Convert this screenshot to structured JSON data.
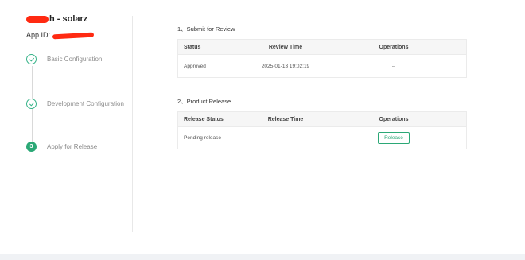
{
  "app": {
    "title_suffix": "h - solarz",
    "id_label": "App ID:"
  },
  "steps": [
    {
      "label": "Basic Configuration",
      "status": "done",
      "icon": "check-circle-icon"
    },
    {
      "label": "Development Configuration",
      "status": "done",
      "icon": "check-circle-icon"
    },
    {
      "label": "Apply for Release",
      "status": "active",
      "number": "3"
    }
  ],
  "review": {
    "title": "1、Submit for Review",
    "headers": [
      "Status",
      "Review Time",
      "Operations"
    ],
    "row": {
      "status": "Approved",
      "time": "2025-01-13 19:02:19",
      "operations": "--"
    }
  },
  "release": {
    "title": "2、Product Release",
    "headers": [
      "Release Status",
      "Release Time",
      "Operations"
    ],
    "row": {
      "status": "Pending release",
      "time": "--",
      "button": "Release"
    }
  },
  "colors": {
    "accent": "#2ba876",
    "redaction": "#ff2a12"
  }
}
